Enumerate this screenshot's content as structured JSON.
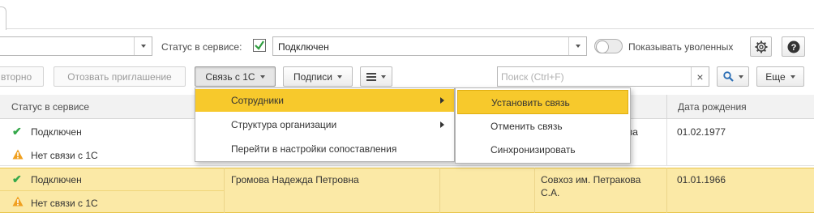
{
  "filters": {
    "left_field_value": "",
    "status_label": "Статус в сервисе:",
    "status_checked": true,
    "status_value": "Подключен",
    "show_fired_label": "Показывать уволенных",
    "show_fired_on": false
  },
  "toolbar": {
    "repeat_label": "вторно",
    "revoke_label": "Отозвать приглашение",
    "link_1c_label": "Связь с 1С",
    "signatures_label": "Подписи",
    "search_placeholder": "Поиск (Ctrl+F)",
    "more_label": "Еще"
  },
  "table": {
    "columns": [
      "Статус в сервисе",
      "Дата рождения"
    ],
    "rows": [
      {
        "status": [
          "Подключен",
          "Нет связи с 1С"
        ],
        "name": "",
        "org": "...кова",
        "birth_date": "01.02.1977",
        "selected": false
      },
      {
        "status": [
          "Подключен",
          "Нет связи с 1С"
        ],
        "name": "Громова Надежда Петровна",
        "org": [
          "Совхоз им. Петракова",
          "С.А."
        ],
        "birth_date": "01.01.1966",
        "selected": true
      }
    ]
  },
  "menu": {
    "items": [
      "Сотрудники",
      "Структура организации",
      "Перейти в настройки сопоставления"
    ],
    "submenu": [
      "Установить связь",
      "Отменить связь",
      "Синхронизировать"
    ]
  },
  "colors": {
    "highlight": "#f7c92c",
    "selected_row": "#fbe9a6",
    "ok": "#35a84a",
    "warning": "#f0a020"
  }
}
